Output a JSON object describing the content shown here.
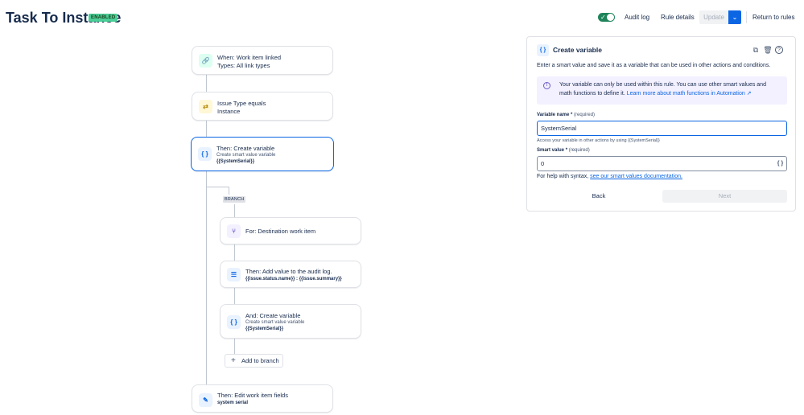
{
  "header": {
    "title": "Task To Instance",
    "status_badge": "ENABLED",
    "audit_log": "Audit log",
    "rule_details": "Rule details",
    "update": "Update",
    "return_to_rules": "Return to rules"
  },
  "flow": {
    "trigger": {
      "line1": "When: Work item linked",
      "line2": "Types: All link types"
    },
    "condition": {
      "line1": "Issue Type equals",
      "line2": "Instance"
    },
    "action_create_variable": {
      "line1": "Then: Create variable",
      "line2": "Create smart value variable",
      "line3": "{{SystemSerial}}"
    },
    "branch_tag": "BRANCH",
    "branch_for": {
      "line1": "For: Destination work item"
    },
    "branch_audit": {
      "line1": "Then: Add value to the audit log.",
      "line2": "{{issue.status.name}} : {{issue.summary}}"
    },
    "branch_create_variable": {
      "line1": "And: Create variable",
      "line2": "Create smart value variable",
      "line3": "{{SystemSerial}}"
    },
    "add_to_branch": "Add to branch",
    "edit_fields": {
      "line1": "Then: Edit work item fields",
      "line2": "system serial"
    }
  },
  "panel": {
    "title": "Create variable",
    "description": "Enter a smart value and save it as a variable that can be used in other actions and conditions.",
    "info_line1": "Your variable can only be used within this rule. You can use other smart values and",
    "info_line2_prefix": "math functions to define it. ",
    "info_link": "Learn more about math functions in Automation ↗",
    "variable_name_label": "Variable name",
    "required_mark": " *",
    "required_text": " (required)",
    "variable_name_value": "SystemSerial",
    "variable_name_help": "Access your variable in other actions by using {{SystemSerial}}",
    "smart_value_label": "Smart value",
    "smart_value_value": "0",
    "syntax_help_prefix": "For help with syntax, ",
    "syntax_help_link": "see our smart values documentation.",
    "back": "Back",
    "next": "Next"
  },
  "icons": {
    "link": "link-icon",
    "swap": "swap-icon",
    "braces": "braces-icon",
    "branch": "branch-icon",
    "log": "log-icon",
    "edit": "edit-icon",
    "duplicate": "duplicate-icon",
    "trash": "trash-icon",
    "help": "help-icon"
  },
  "colors": {
    "accent": "#0c66e4",
    "enabled": "#4bce97",
    "toggle_on": "#1f845a"
  }
}
